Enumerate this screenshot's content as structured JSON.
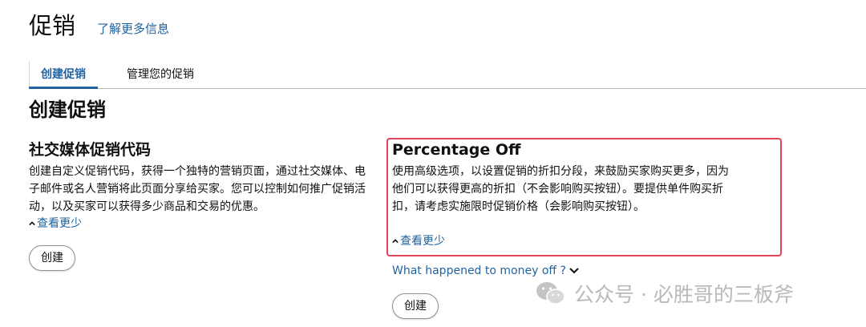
{
  "header": {
    "title": "促销",
    "learn_more": "了解更多信息"
  },
  "tabs": [
    {
      "label": "创建促销",
      "active": true
    },
    {
      "label": "管理您的促销",
      "active": false
    }
  ],
  "section_title": "创建促销",
  "cards": {
    "social": {
      "title": "社交媒体促销代码",
      "description": "创建自定义促销代码，获得一个独特的营销页面，通过社交媒体、电子邮件或名人营销将此页面分享给买家。您可以控制如何推广促销活动，以及买家可以获得多少商品和交易的优惠。",
      "toggle": "查看更少",
      "button": "创建"
    },
    "percentage": {
      "title": "Percentage Off",
      "description": "使用高级选项，以设置促销的折扣分段，来鼓励买家购买更多，因为他们可以获得更高的折扣（不会影响购买按钮）。要提供单件购买折扣，请考虑实施限时促销价格（会影响购买按钮）。",
      "toggle": "查看更少",
      "money_link": "What happened to money off ?",
      "button": "创建"
    }
  },
  "watermark": "公众号 · 必胜哥的三板斧",
  "colors": {
    "link": "#2162a1",
    "highlight_border": "#e0435a",
    "text": "#0f1111"
  }
}
